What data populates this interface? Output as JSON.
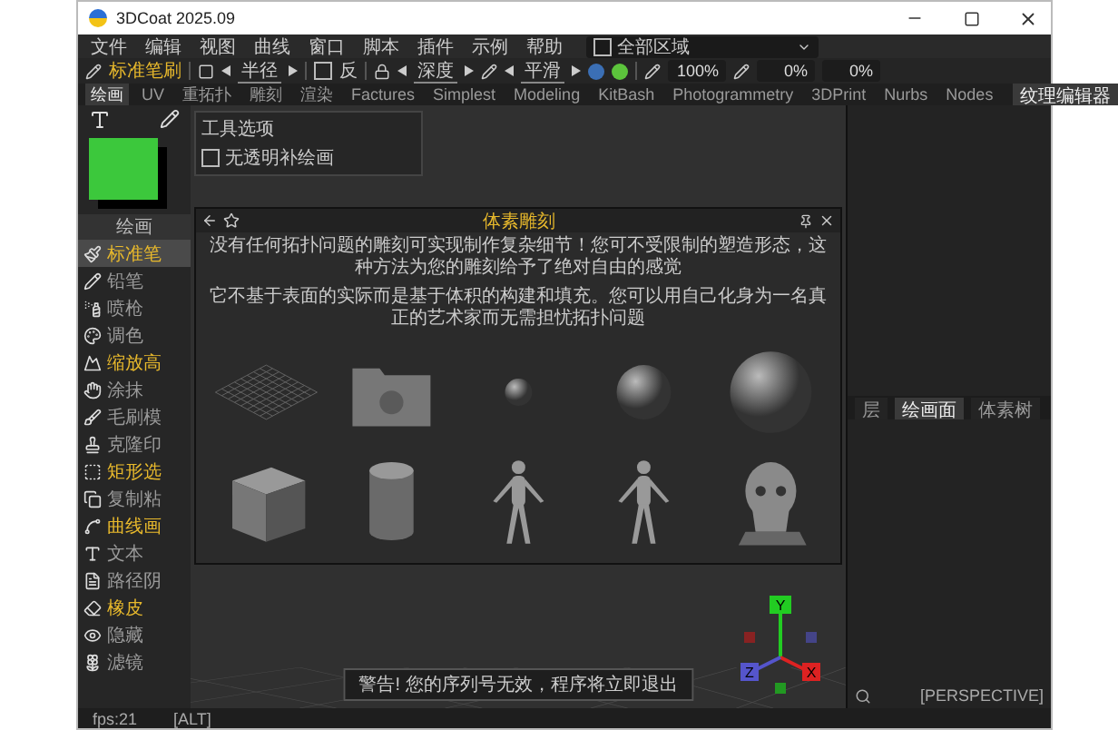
{
  "window": {
    "title": "3DCoat 2025.09"
  },
  "menu": [
    "文件",
    "编辑",
    "视图",
    "曲线",
    "窗口",
    "脚本",
    "插件",
    "示例",
    "帮助"
  ],
  "area_select": {
    "label": "全部区域",
    "checked": false
  },
  "toolbar": {
    "brush": "标准笔刷",
    "radius": "半径",
    "invert": {
      "label": "反",
      "checked": false
    },
    "depth": "深度",
    "smooth": "平滑",
    "opacity": "100%",
    "value_1": "0%",
    "value_2": "0%"
  },
  "rooms": [
    {
      "label": "绘画",
      "selected": true
    },
    {
      "label": "UV",
      "selected": false
    },
    {
      "label": "重拓扑",
      "selected": false
    },
    {
      "label": "雕刻",
      "selected": false
    },
    {
      "label": "渲染",
      "selected": false
    },
    {
      "label": "Factures",
      "selected": false
    },
    {
      "label": "Simplest",
      "selected": false
    },
    {
      "label": "Modeling",
      "selected": false
    },
    {
      "label": "KitBash",
      "selected": false
    },
    {
      "label": "Photogrammetry",
      "selected": false
    },
    {
      "label": "3DPrint",
      "selected": false
    },
    {
      "label": "Nurbs",
      "selected": false
    },
    {
      "label": "Nodes",
      "selected": false
    }
  ],
  "texture_editor_tab": "纹理编辑器",
  "palette": {
    "label": "绘画",
    "color": "#3cc83c"
  },
  "tools": [
    {
      "label": "标准笔",
      "selected": true,
      "accent": true
    },
    {
      "label": "铅笔",
      "selected": false,
      "accent": false
    },
    {
      "label": "喷枪",
      "selected": false,
      "accent": false
    },
    {
      "label": "调色",
      "selected": false,
      "accent": false
    },
    {
      "label": "缩放高",
      "selected": false,
      "accent": true
    },
    {
      "label": "涂抹",
      "selected": false,
      "accent": false
    },
    {
      "label": "毛刷模",
      "selected": false,
      "accent": false
    },
    {
      "label": "克隆印",
      "selected": false,
      "accent": false
    },
    {
      "label": "矩形选",
      "selected": false,
      "accent": true
    },
    {
      "label": "复制粘",
      "selected": false,
      "accent": false
    },
    {
      "label": "曲线画",
      "selected": false,
      "accent": true
    },
    {
      "label": "文本",
      "selected": false,
      "accent": false
    },
    {
      "label": "路径阴",
      "selected": false,
      "accent": false
    },
    {
      "label": "橡皮",
      "selected": false,
      "accent": true
    },
    {
      "label": "隐藏",
      "selected": false,
      "accent": false
    },
    {
      "label": "滤镜",
      "selected": false,
      "accent": false
    }
  ],
  "tool_options": {
    "title": "工具选项",
    "option": {
      "label": "无透明补绘画",
      "checked": false
    }
  },
  "dialog": {
    "title": "体素雕刻",
    "description": [
      "没有任何拓扑问题的雕刻可实现制作复杂细节！您可不受限制的塑造形态，这种方法为您的雕刻给予了绝对自由的感觉",
      "它不基于表面的实际而是基于体积的构建和填充。您可以用自己化身为一名真正的艺术家而无需担忧拓扑问题"
    ]
  },
  "panel_tabs": [
    {
      "label": "层",
      "selected": false
    },
    {
      "label": "绘画面",
      "selected": true
    },
    {
      "label": "体素树",
      "selected": false
    }
  ],
  "gizmo": {
    "y": "Y",
    "z": "Z",
    "x": "X"
  },
  "warning": "警告! 您的序列号无效，程序将立即退出",
  "status": {
    "fps": "fps:21",
    "mode": "[ALT]",
    "view": "[PERSPECTIVE]"
  }
}
